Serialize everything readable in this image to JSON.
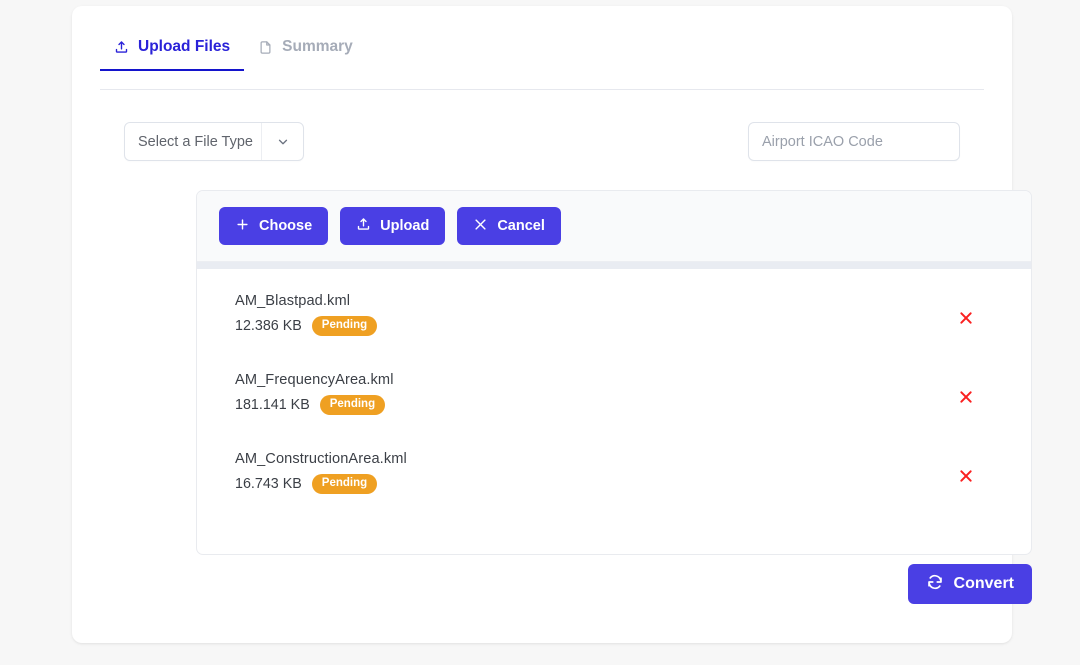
{
  "tabs": [
    {
      "label": "Upload Files",
      "icon": "upload-icon",
      "active": true
    },
    {
      "label": "Summary",
      "icon": "document-icon",
      "active": false
    }
  ],
  "form": {
    "file_type_select": {
      "value": "Select a File Type",
      "caret_icon": "chevron-down-icon"
    },
    "icao": {
      "placeholder": "Airport ICAO Code",
      "value": ""
    }
  },
  "uploader": {
    "buttons": [
      {
        "label": "Choose",
        "icon": "plus-icon"
      },
      {
        "label": "Upload",
        "icon": "upload-icon"
      },
      {
        "label": "Cancel",
        "icon": "close-icon"
      }
    ],
    "progress_percent": 0,
    "files": [
      {
        "name": "AM_Blastpad.kml",
        "size": "12.386 KB",
        "status": "Pending",
        "remove_icon": "close-icon"
      },
      {
        "name": "AM_FrequencyArea.kml",
        "size": "181.141 KB",
        "status": "Pending",
        "remove_icon": "close-icon"
      },
      {
        "name": "AM_ConstructionArea.kml",
        "size": "16.743 KB",
        "status": "Pending",
        "remove_icon": "close-icon"
      }
    ]
  },
  "convert": {
    "label": "Convert",
    "icon": "refresh-icon"
  },
  "colors": {
    "primary": "#4a3fe4",
    "tab_active": "#2a22d8",
    "tab_inactive": "#a6acb8",
    "badge_pending": "#efa022",
    "remove_icon": "#fa2020",
    "page_background": "#f7f7f7",
    "card_background": "#ffffff"
  }
}
